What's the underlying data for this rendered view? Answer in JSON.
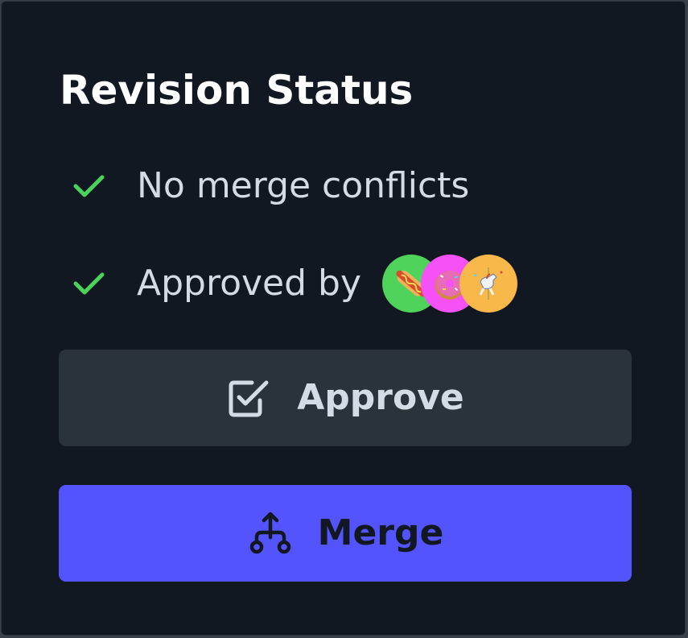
{
  "revision_status": {
    "title": "Revision Status",
    "checks": [
      {
        "label": "No merge conflicts",
        "icon": "check-icon",
        "color": "#4ad25a"
      },
      {
        "label": "Approved by",
        "icon": "check-icon",
        "color": "#4ad25a"
      }
    ],
    "approvers": [
      {
        "emoji": "hot-dog",
        "bg": "#4fd35a"
      },
      {
        "emoji": "doughnut",
        "bg": "#f651f6"
      },
      {
        "emoji": "carousel-horse",
        "bg": "#f9b84a"
      }
    ]
  },
  "actions": {
    "approve": {
      "label": "Approve",
      "icon": "checkbox-icon",
      "bg": "#2a323c"
    },
    "merge": {
      "label": "Merge",
      "icon": "git-merge-icon",
      "bg": "#5454ff"
    }
  }
}
